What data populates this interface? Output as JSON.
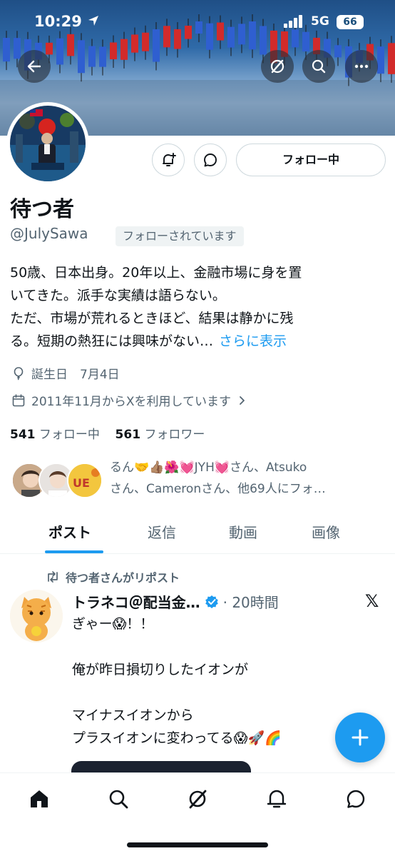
{
  "status_bar": {
    "time": "10:29",
    "network": "5G",
    "battery": "66"
  },
  "header": {
    "back_icon": "arrow-left-icon",
    "grok_icon": "grok-icon",
    "search_icon": "search-icon",
    "more_icon": "more-horizontal-icon"
  },
  "profile": {
    "display_name": "待つ者",
    "handle": "@JulySawa",
    "follows_you_badge": "フォローされています",
    "follow_button_label": "フォロー中",
    "bio_lines": [
      "50歳、日本出身。20年以上、金融市場に身を置",
      "いてきた。派手な実績は語らない。",
      "ただ、市場が荒れるときほど、結果は静かに残",
      "る。短期の熱狂には興味がない…"
    ],
    "bio_more_link": "さらに表示",
    "birthday": "誕生日　7月4日",
    "joined": "2011年11月からXを利用しています",
    "following_count": "541",
    "following_label": "フォロー中",
    "followers_count": "561",
    "followers_label": "フォロワー",
    "followed_by_line1": "るん🤝👍🏽🌺💓JYH💓さん、Atsuko",
    "followed_by_line2": "さん、Cameronさん、他69人にフォ…"
  },
  "tabs": [
    {
      "label": "ポスト",
      "active": true
    },
    {
      "label": "返信",
      "active": false
    },
    {
      "label": "動画",
      "active": false
    },
    {
      "label": "画像",
      "active": false
    }
  ],
  "post": {
    "repost_label": "待つ者さんがリポスト",
    "author": "トラネコ＠配当金…",
    "time": "· 20時間",
    "lines": [
      "ぎゃー😱！！",
      "",
      "俺が昨日損切りしたイオンが",
      "",
      "マイナスイオンから",
      "プラスイオンに変わってる😱🚀🌈"
    ]
  },
  "colors": {
    "accent": "#1d9bf0",
    "text_primary": "#0f1419",
    "text_secondary": "#536471",
    "border": "#cfd9de"
  },
  "bottom_nav": [
    "home-icon",
    "search-icon",
    "grok-icon",
    "notifications-icon",
    "messages-icon"
  ]
}
